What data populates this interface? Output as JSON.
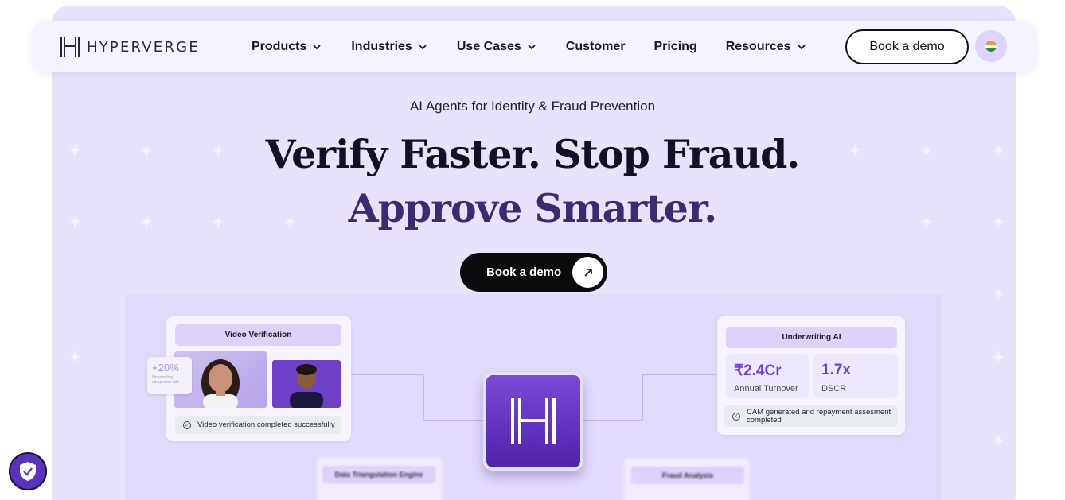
{
  "brand": {
    "name": "HYPERVERGE"
  },
  "nav": {
    "items": [
      {
        "label": "Products",
        "has_dropdown": true
      },
      {
        "label": "Industries",
        "has_dropdown": true
      },
      {
        "label": "Use Cases",
        "has_dropdown": true
      },
      {
        "label": "Customer",
        "has_dropdown": false
      },
      {
        "label": "Pricing",
        "has_dropdown": false
      },
      {
        "label": "Resources",
        "has_dropdown": true
      }
    ],
    "cta_label": "Book a demo",
    "region_icon": "india-flag-icon"
  },
  "hero": {
    "eyebrow": "AI Agents for Identity & Fraud Prevention",
    "headline_line1": "Verify Faster. Stop Fraud.",
    "headline_line2": "Approve Smarter.",
    "cta_label": "Book a demo",
    "cta_icon": "arrow-up-right-icon"
  },
  "diagram": {
    "video_card": {
      "title": "Video Verification",
      "status": "Video verification completed successfully"
    },
    "tooltip": {
      "value": "+20%",
      "label": "Onboarding completion rate"
    },
    "underwriting_card": {
      "title": "Underwriting AI",
      "metrics": [
        {
          "value": "₹2.4Cr",
          "label": "Annual Turnover"
        },
        {
          "value": "1.7x",
          "label": "DSCR"
        }
      ],
      "status": "CAM generated and repayment assesment completed"
    },
    "blurred_cards": [
      {
        "title": "Data Triangulation Engine"
      },
      {
        "title": "Fraud Analysis"
      }
    ]
  },
  "colors": {
    "hero_bg": "#e8e2fb",
    "accent_purple": "#6d42d9",
    "headline_dark": "#15101f",
    "headline_purple": "#3e2a6e"
  },
  "widgets": {
    "privacy_icon": "shield-check-icon"
  }
}
